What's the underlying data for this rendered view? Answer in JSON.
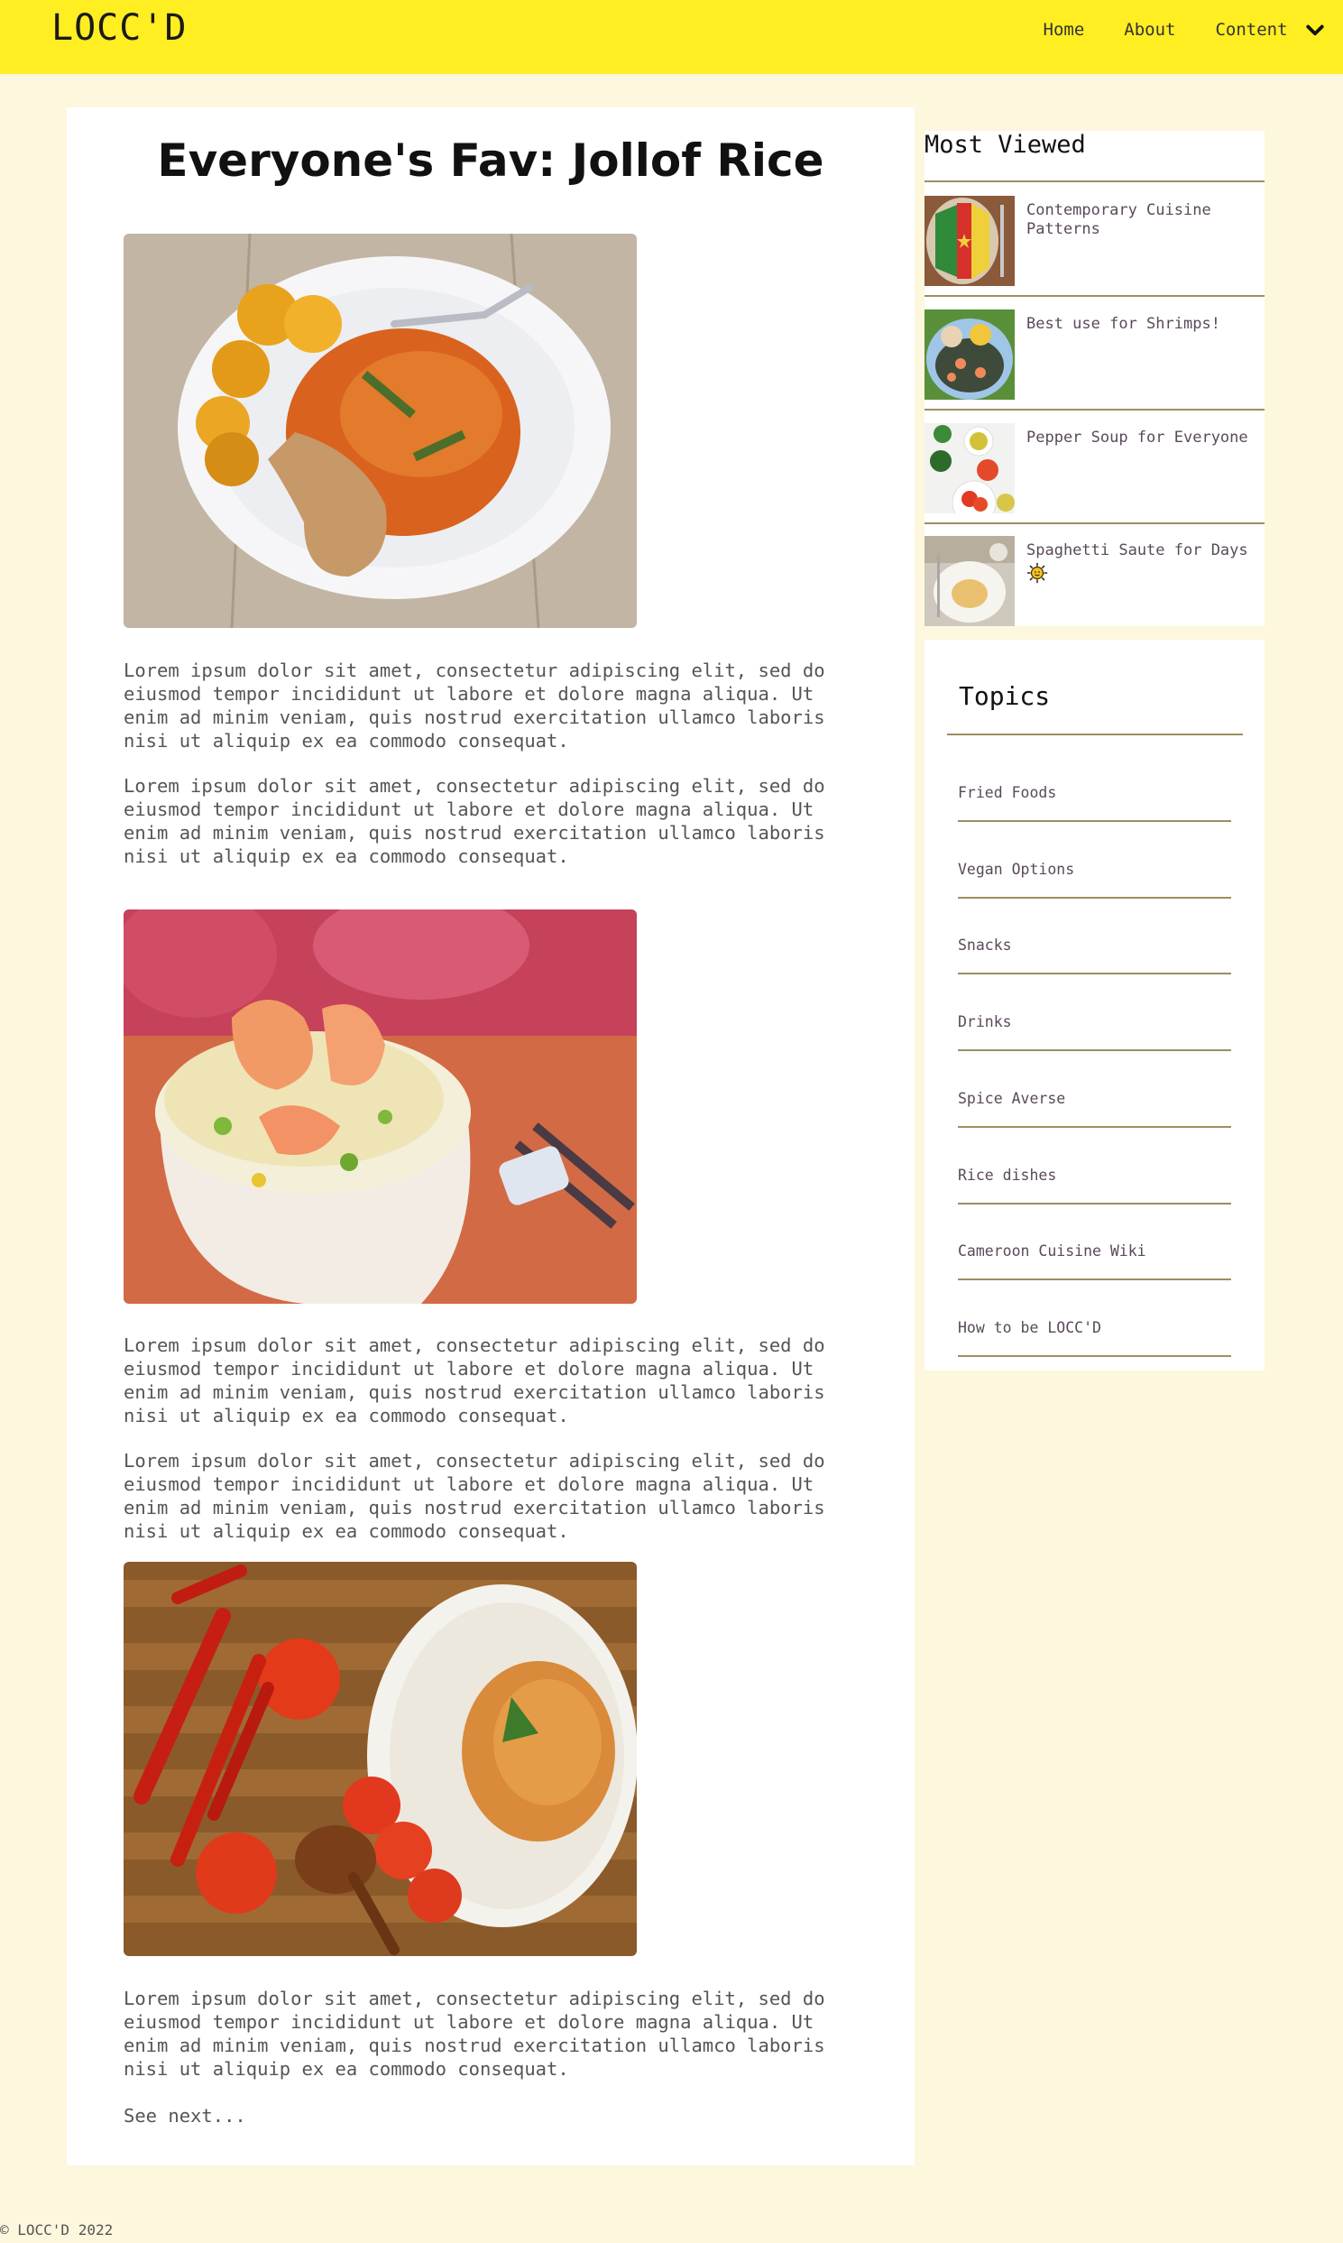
{
  "header": {
    "logo": "LOCC'D",
    "nav": [
      "Home",
      "About",
      "Content"
    ]
  },
  "article": {
    "title": "Everyone's Fav: Jollof Rice",
    "paragraphs": [
      "Lorem ipsum dolor sit amet, consectetur adipiscing elit, sed do eiusmod tempor incididunt ut labore et dolore magna aliqua. Ut enim ad minim veniam, quis nostrud exercitation ullamco laboris nisi ut aliquip ex ea commodo consequat.",
      "Lorem ipsum dolor sit amet, consectetur adipiscing elit, sed do eiusmod tempor incididunt ut labore et dolore magna aliqua. Ut enim ad minim veniam, quis nostrud exercitation ullamco laboris nisi ut aliquip ex ea commodo consequat.",
      "Lorem ipsum dolor sit amet, consectetur adipiscing elit, sed do eiusmod tempor incididunt ut labore et dolore magna aliqua. Ut enim ad minim veniam, quis nostrud exercitation ullamco laboris nisi ut aliquip ex ea commodo consequat.",
      "Lorem ipsum dolor sit amet, consectetur adipiscing elit, sed do eiusmod tempor incididunt ut labore et dolore magna aliqua. Ut enim ad minim veniam, quis nostrud exercitation ullamco laboris nisi ut aliquip ex ea commodo consequat.",
      "Lorem ipsum dolor sit amet, consectetur adipiscing elit, sed do eiusmod tempor incididunt ut labore et dolore magna aliqua. Ut enim ad minim veniam, quis nostrud exercitation ullamco laboris nisi ut aliquip ex ea commodo consequat."
    ],
    "see_next": "See next..."
  },
  "most_viewed": {
    "heading": "Most Viewed",
    "items": [
      "Contemporary Cuisine Patterns",
      "Best use for Shrimps!",
      "Pepper Soup for Everyone",
      "Spaghetti Saute for Days"
    ]
  },
  "topics": {
    "heading": "Topics",
    "items": [
      "Fried Foods",
      "Vegan Options",
      "Snacks",
      "Drinks",
      "Spice Averse",
      "Rice dishes",
      "Cameroon Cuisine Wiki",
      "How to be LOCC'D"
    ]
  },
  "footer": "© LOCC'D 2022",
  "colors": {
    "header_bg": "#ffee22",
    "page_bg": "#fcf7dd",
    "divider": "#9a9060"
  }
}
